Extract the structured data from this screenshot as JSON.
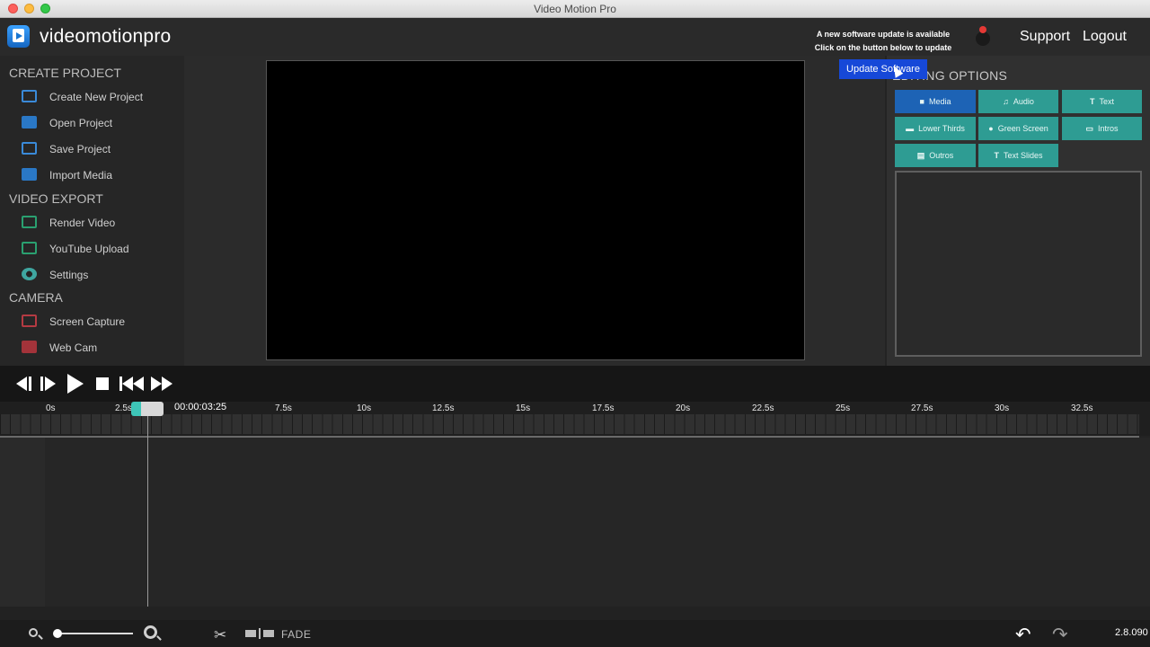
{
  "window": {
    "title": "Video Motion Pro"
  },
  "header": {
    "brand": "videomotionpro",
    "update_notice_line1": "A new software update is available",
    "update_notice_line2": "Click on the button below to update",
    "update_button": "Update Software",
    "support": "Support",
    "logout": "Logout"
  },
  "sidebar": {
    "create_project": {
      "title": "CREATE PROJECT",
      "items": [
        {
          "label": "Create New Project",
          "icon": "monitor-icon"
        },
        {
          "label": "Open Project",
          "icon": "folder-icon"
        },
        {
          "label": "Save Project",
          "icon": "save-icon"
        },
        {
          "label": "Import Media",
          "icon": "folder-icon"
        }
      ]
    },
    "video_export": {
      "title": "VIDEO EXPORT",
      "items": [
        {
          "label": "Render Video",
          "icon": "render-icon"
        },
        {
          "label": "YouTube Upload",
          "icon": "youtube-icon"
        },
        {
          "label": "Settings",
          "icon": "gear-icon"
        }
      ]
    },
    "camera": {
      "title": "CAMERA",
      "items": [
        {
          "label": "Screen Capture",
          "icon": "screen-capture-icon"
        },
        {
          "label": "Web Cam",
          "icon": "webcam-icon"
        }
      ]
    }
  },
  "panel": {
    "title": "EDITING OPTIONS",
    "tabs": [
      {
        "label": "Media",
        "glyph": "■",
        "active": true
      },
      {
        "label": "Audio",
        "glyph": "♫",
        "active": false
      },
      {
        "label": "Text",
        "glyph": "T",
        "active": false
      },
      {
        "label": "Lower Thirds",
        "glyph": "▬",
        "active": false
      },
      {
        "label": "Green Screen",
        "glyph": "●",
        "active": false
      },
      {
        "label": "Intros",
        "glyph": "▭",
        "active": false
      },
      {
        "label": "Outros",
        "glyph": "▤",
        "active": false
      },
      {
        "label": "Text Slides",
        "glyph": "T",
        "active": false
      }
    ]
  },
  "timeline": {
    "timecode": "00:00:03:25",
    "ruler": [
      "0s",
      "2.5s",
      "7.5s",
      "10s",
      "12.5s",
      "15s",
      "17.5s",
      "20s",
      "22.5s",
      "25s",
      "27.5s",
      "30s",
      "32.5s"
    ]
  },
  "bottom": {
    "fade": "FADE",
    "version": "2.8.090"
  },
  "colors": {
    "accent_teal": "#2e9c93",
    "accent_blue": "#1d63b5",
    "update_blue": "#1648d8"
  }
}
